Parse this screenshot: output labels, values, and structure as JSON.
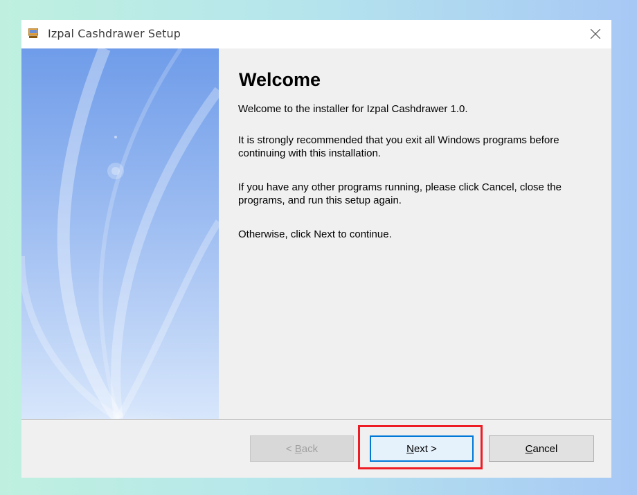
{
  "window": {
    "title": "Izpal Cashdrawer Setup"
  },
  "content": {
    "heading": "Welcome",
    "paragraphs": [
      "Welcome to the installer for Izpal Cashdrawer 1.0.",
      "It is strongly recommended that you exit all Windows programs before continuing with this installation.",
      "If you have any other programs running, please click Cancel, close the programs, and run this setup again.",
      "Otherwise, click Next to continue."
    ]
  },
  "buttons": {
    "back": {
      "before": "< ",
      "mnemonic": "B",
      "rest": "ack"
    },
    "next": {
      "mnemonic": "N",
      "rest": "ext >"
    },
    "cancel": {
      "mnemonic": "C",
      "rest": "ancel"
    }
  },
  "colors": {
    "highlight": "#ee1c24",
    "focus_border": "#0078d7",
    "banner_top": "#6f9ce9",
    "banner_bottom": "#d7e6fb"
  }
}
